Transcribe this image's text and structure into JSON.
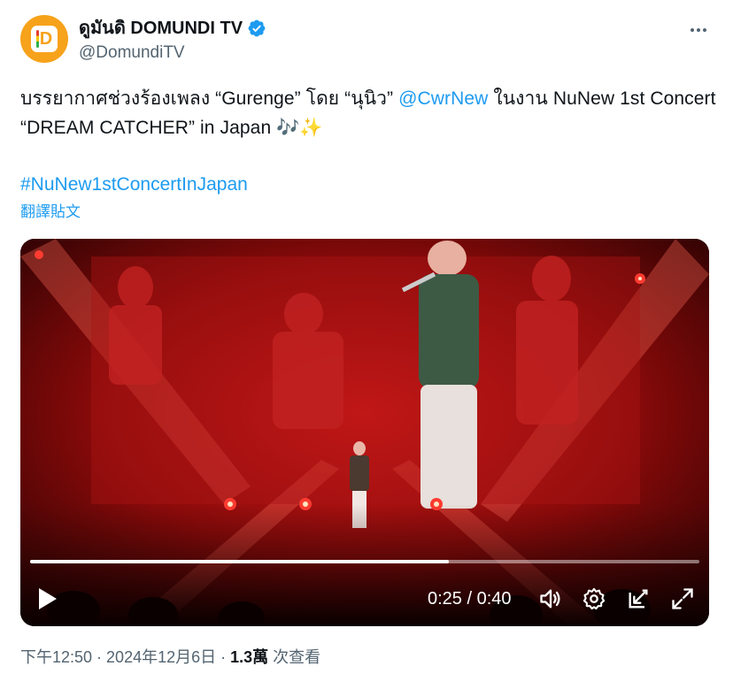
{
  "author": {
    "display_name": "ดูมันดิ DOMUNDI TV",
    "handle": "@DomundiTV",
    "avatar_letter": "D",
    "verified": true
  },
  "tweet": {
    "text_part1": "บรรยากาศช่วงร้องเพลง “Gurenge” โดย “นุนิว” ",
    "mention": "@CwrNew",
    "text_part2": " ในงาน NuNew 1st Concert “DREAM CATCHER” in Japan 🎶✨",
    "hashtag": "#NuNew1stConcertInJapan",
    "translate_label": "翻譯貼文"
  },
  "video": {
    "current_time": "0:25",
    "separator": " / ",
    "duration": "0:40",
    "progress_fraction": 0.625
  },
  "footer": {
    "time": "下午12:50",
    "dot1": " · ",
    "date": "2024年12月6日",
    "dot2": " · ",
    "views": "1.3萬",
    "views_label": " 次查看"
  },
  "colors": {
    "accent": "#1d9bf0",
    "avatar": "#f7a21b",
    "muted": "#536471"
  },
  "icons": [
    "verified-badge-icon",
    "more-icon",
    "play-icon",
    "volume-icon",
    "settings-icon",
    "minimize-icon",
    "fullscreen-icon"
  ]
}
